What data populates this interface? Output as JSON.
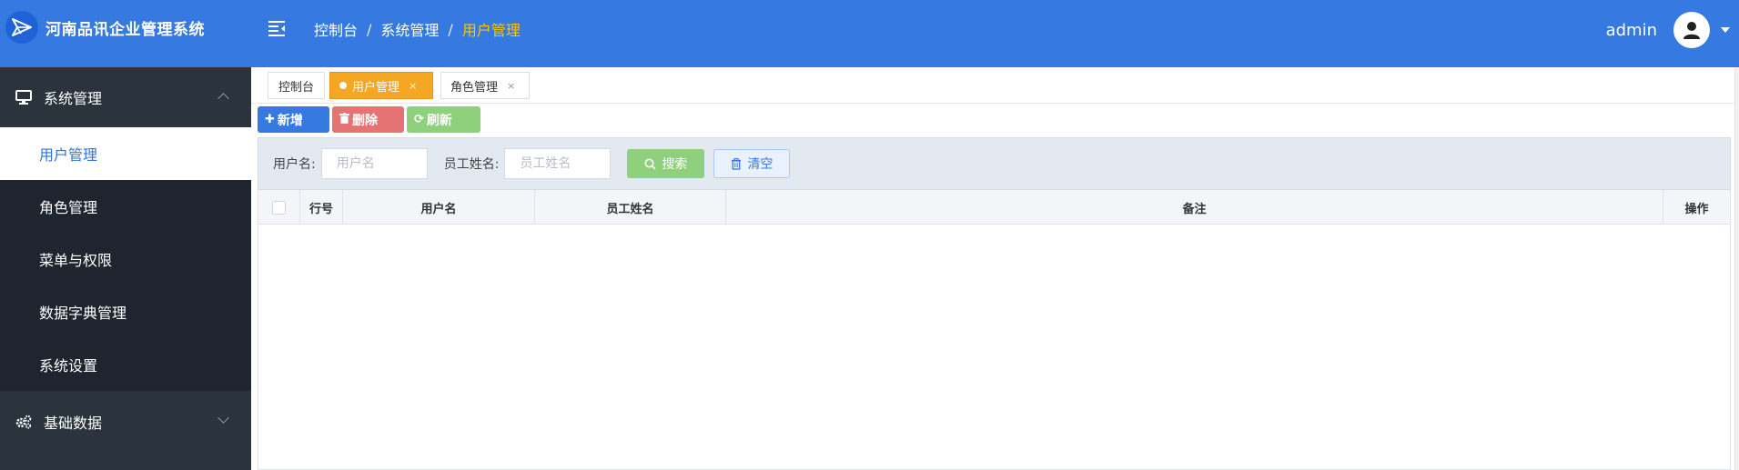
{
  "app": {
    "title": "河南品讯企业管理系统",
    "accent": "#3579e1",
    "sidebar_bg": "#2b333d"
  },
  "header": {
    "menu_toggle_icon": "menu-fold-icon",
    "breadcrumb": [
      "控制台",
      "系统管理",
      "用户管理"
    ],
    "breadcrumb_sep": "/",
    "username": "admin",
    "avatar_icon": "user-icon"
  },
  "sidebar": {
    "groups": [
      {
        "label": "系统管理",
        "icon": "monitor-icon",
        "expanded": true,
        "items": [
          {
            "label": "用户管理",
            "active": true
          },
          {
            "label": "角色管理",
            "active": false
          },
          {
            "label": "菜单与权限",
            "active": false
          },
          {
            "label": "数据字典管理",
            "active": false
          },
          {
            "label": "系统设置",
            "active": false
          }
        ]
      },
      {
        "label": "基础数据",
        "icon": "gears-icon",
        "expanded": false
      }
    ]
  },
  "tabs": [
    {
      "label": "控制台",
      "closable": false,
      "active": false
    },
    {
      "label": "用户管理",
      "closable": true,
      "active": true
    },
    {
      "label": "角色管理",
      "closable": true,
      "active": false
    }
  ],
  "tab_close": "×",
  "toolbar": {
    "add": "新增",
    "delete": "删除",
    "refresh": "刷新",
    "add_color": "#3579e1",
    "delete_color": "#e57373",
    "refresh_color": "#8fd07c"
  },
  "search": {
    "username_label": "用户名:",
    "username_placeholder": "用户名",
    "username_value": "",
    "empname_label": "员工姓名:",
    "empname_placeholder": "员工姓名",
    "empname_value": "",
    "search_btn": "搜索",
    "clear_btn": "清空"
  },
  "table": {
    "columns": [
      "行号",
      "用户名",
      "员工姓名",
      "备注",
      "操作"
    ],
    "rows": []
  }
}
